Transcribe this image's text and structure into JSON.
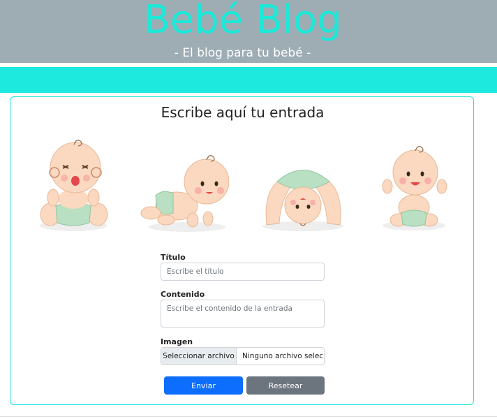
{
  "header": {
    "title": "Bebé Blog",
    "subtitle": "- El blog para tu bebé -"
  },
  "colors": {
    "header_bg": "#9eacb4",
    "accent": "#1de9df",
    "primary": "#0d6efd",
    "secondary": "#6c757d"
  },
  "card": {
    "title": "Escribe aquí tu entrada"
  },
  "illustrations": [
    "baby-sitting-crying-icon",
    "baby-crawling-icon",
    "baby-upside-down-icon",
    "baby-sitting-happy-icon"
  ],
  "form": {
    "title_label": "Título",
    "title_placeholder": "Escribe el título",
    "content_label": "Contenido",
    "content_placeholder": "Escribe el contenido de la entrada",
    "image_label": "Imagen",
    "file_button": "Seleccionar archivo",
    "file_status": "Ninguno archivo selec.",
    "submit_label": "Enviar",
    "reset_label": "Resetear"
  }
}
